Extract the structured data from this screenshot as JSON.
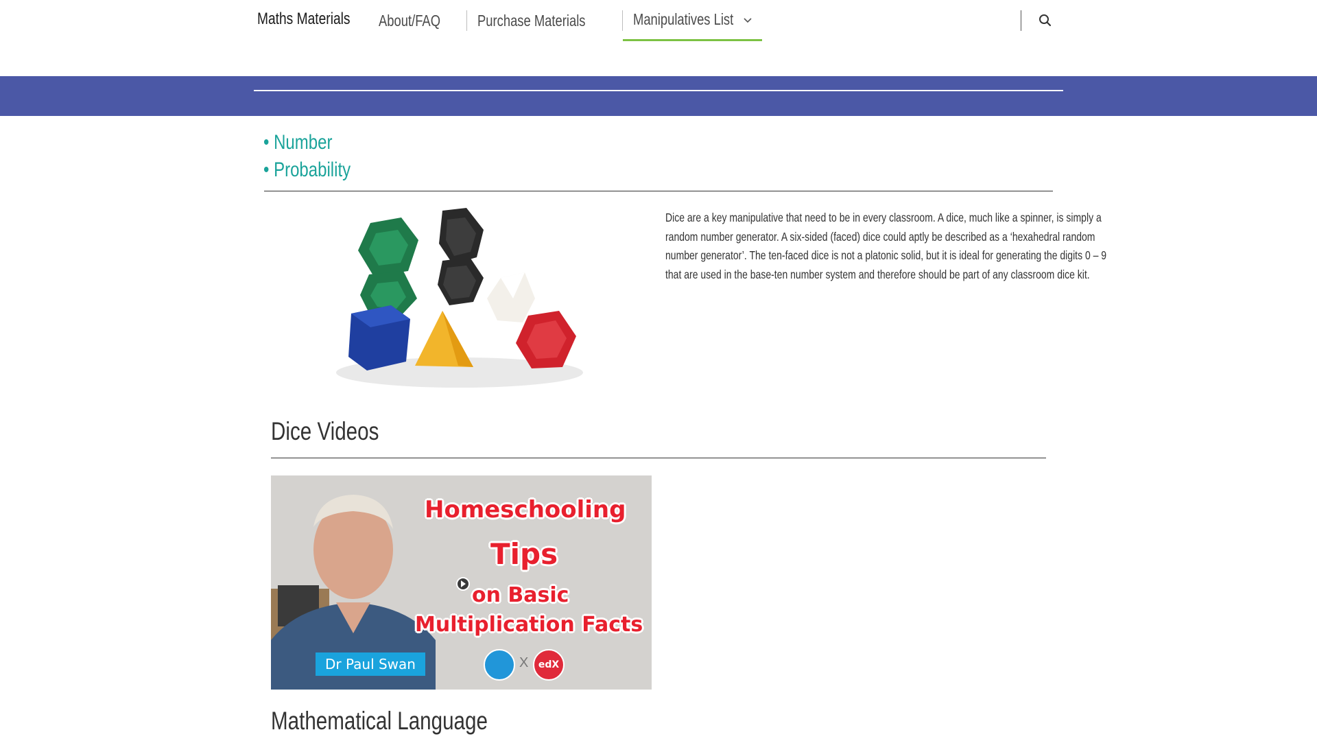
{
  "header": {
    "site_title": "Maths Materials",
    "nav": [
      {
        "label": "About/FAQ"
      },
      {
        "label": "Purchase Materials"
      },
      {
        "label": "Manipulatives List"
      }
    ],
    "active_accent": "#7cc243",
    "search_icon": "search-icon"
  },
  "band": {
    "color": "#4b58a6"
  },
  "categories": [
    "• Number",
    "• Probability"
  ],
  "description": "Dice are a key manipulative that need to be in every classroom. A dice, much like a spinner, is simply a random number generator. A six-sided (faced) dice could aptly be described as a ‘hexahedral random number generator’. The ten-faced dice is not a platonic solid, but it is ideal for generating the digits 0 – 9 that are used in the base-ten number system and therefore should be part of any classroom dice kit.",
  "videos_section": {
    "title": "Dice Videos",
    "video": {
      "line1": "Homeschooling",
      "line2": "Tips",
      "line3": "on Basic",
      "line4": "Multiplication Facts",
      "presenter": "Dr Paul Swan",
      "x_mark": "X",
      "partner": "edX"
    }
  },
  "next_section": {
    "title": "Mathematical Language"
  }
}
